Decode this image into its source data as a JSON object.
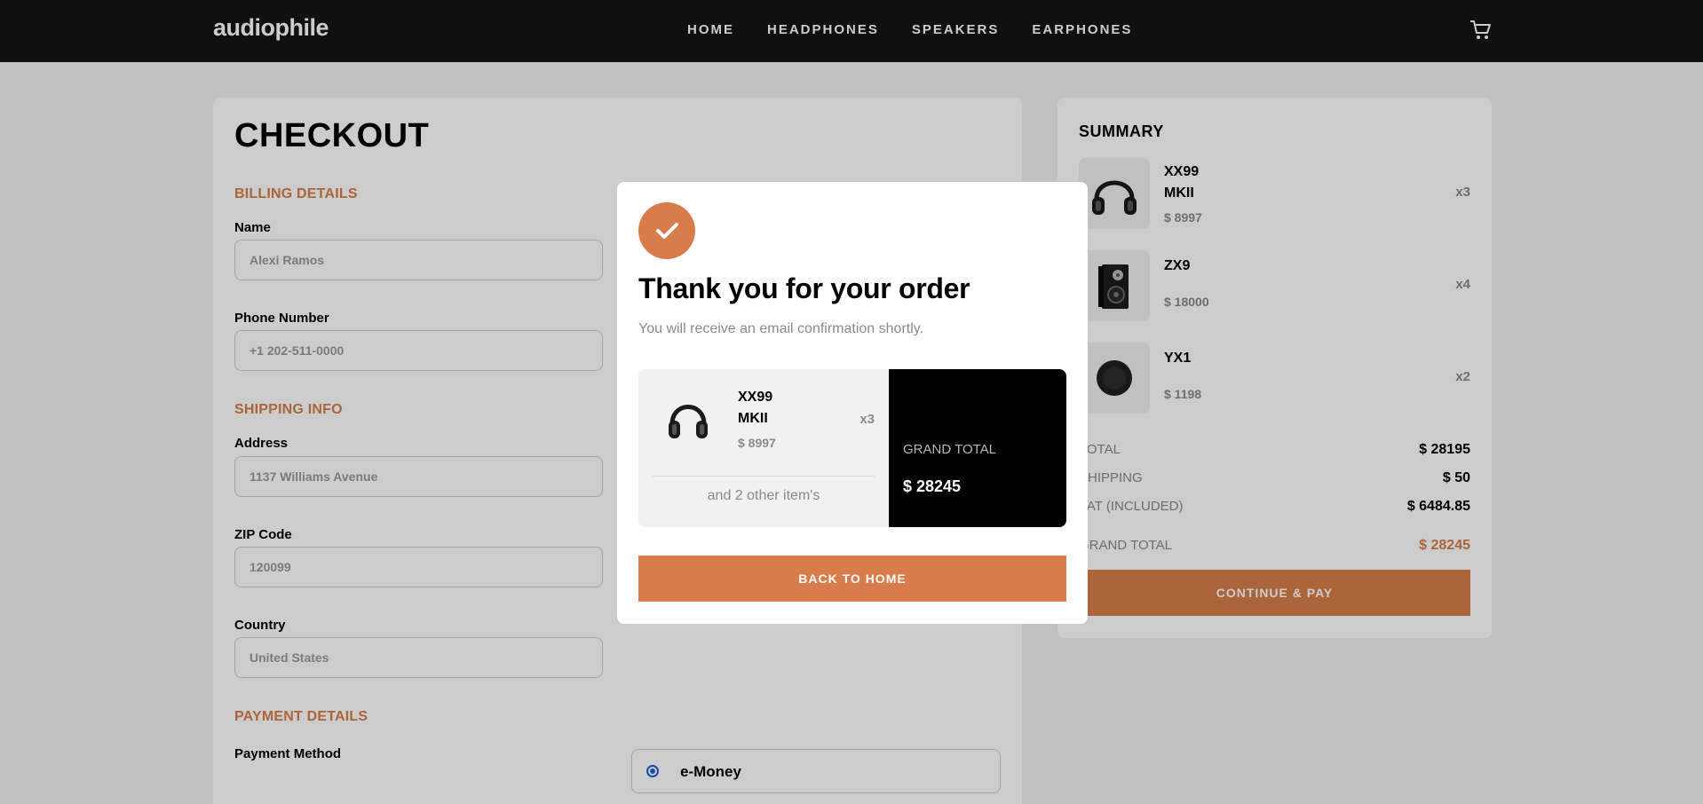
{
  "header": {
    "logo": "audiophile",
    "nav": [
      "HOME",
      "HEADPHONES",
      "SPEAKERS",
      "EARPHONES"
    ],
    "cart_icon": "cart-icon"
  },
  "checkout": {
    "title": "CHECKOUT",
    "billing": {
      "heading": "BILLING DETAILS",
      "name_label": "Name",
      "name_placeholder": "Alexi Ramos",
      "phone_label": "Phone Number",
      "phone_placeholder": "+1 202-511-0000"
    },
    "shipping": {
      "heading": "SHIPPING INFO",
      "address_label": "Address",
      "address_placeholder": "1137 Williams Avenue",
      "zip_label": "ZIP Code",
      "zip_placeholder": "120099",
      "country_label": "Country",
      "country_placeholder": "United States"
    },
    "payment": {
      "heading": "PAYMENT DETAILS",
      "method_label": "Payment Method",
      "option_emoney": "e-Money"
    }
  },
  "summary": {
    "title": "SUMMARY",
    "items": [
      {
        "name_line1": "XX99",
        "name_line2": "MKII",
        "price": "$ 8997",
        "qty": "x3",
        "icon": "headphones-icon"
      },
      {
        "name_line1": "ZX9",
        "name_line2": "",
        "price": "$ 18000",
        "qty": "x4",
        "icon": "speaker-icon"
      },
      {
        "name_line1": "YX1",
        "name_line2": "",
        "price": "$ 1198",
        "qty": "x2",
        "icon": "earphones-icon"
      }
    ],
    "total_label": "TOTAL",
    "total_value": "$ 28195",
    "shipping_label": "SHIPPING",
    "shipping_value": "$ 50",
    "vat_label": "VAT (INCLUDED)",
    "vat_value": "$ 6484.85",
    "grand_label": "GRAND TOTAL",
    "grand_value": "$ 28245",
    "pay_button": "CONTINUE & PAY"
  },
  "modal": {
    "title": "Thank you for your order",
    "subtitle": "You will receive an email confirmation shortly.",
    "item_name_line1": "XX99",
    "item_name_line2": "MKII",
    "item_price": "$ 8997",
    "item_qty": "x3",
    "other_items": "and 2 other item's",
    "grand_total_label": "GRAND TOTAL",
    "grand_total_value": "$ 28245",
    "back_button": "BACK TO HOME"
  },
  "colors": {
    "accent": "#d87d4a",
    "header_bg": "#141414",
    "overlay": "rgba(0,0,0,0.2)"
  }
}
